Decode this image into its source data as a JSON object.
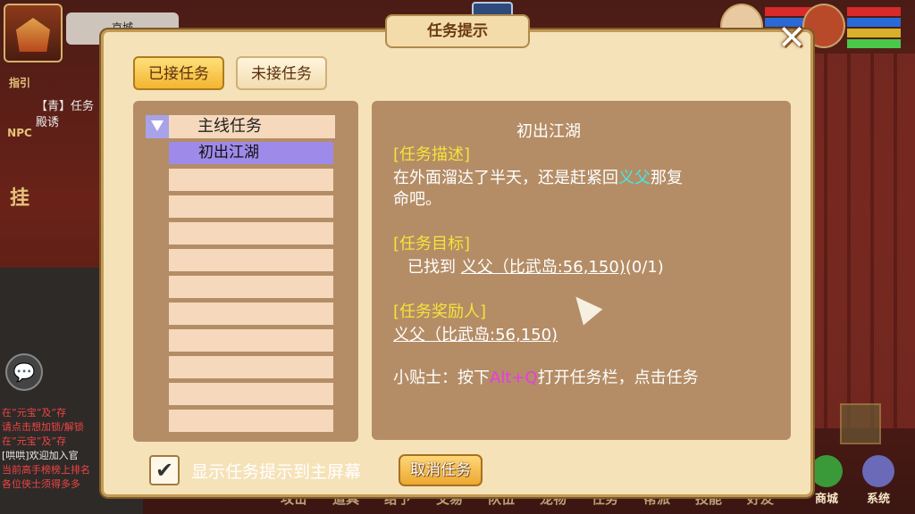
{
  "hud": {
    "location": "京城",
    "left_icons": [
      "指引",
      "NPC",
      "挂"
    ],
    "side_task_lines": [
      "【青】任务",
      "殿诱"
    ],
    "chat_lines": [
      "在”元宝”及”存",
      "请点击想加锁/解锁",
      "在”元宝”及”存",
      "[哄哄]欢迎加入官",
      "当前高手榜榜上排名",
      "各位侠士须得多多"
    ],
    "bottom_menu": [
      "攻击",
      "道具",
      "给予",
      "交易",
      "队伍",
      "宠物",
      "任务",
      "帮派",
      "技能",
      "好友"
    ],
    "mall_label": "商城",
    "system_label": "系统"
  },
  "dialog": {
    "title": "任务提示",
    "close_symbol": "✕",
    "tabs": {
      "accepted": "已接任务",
      "unaccepted": "未接任务"
    },
    "list": {
      "category": "主线任务",
      "items": [
        "初出江湖"
      ]
    },
    "detail": {
      "title": "初出江湖",
      "desc_header": "[任务描述]",
      "desc_line1_pre": "在外面溜达了半天，还是赶紧回",
      "desc_line1_npc": "义父",
      "desc_line1_post": "那复",
      "desc_line2": "命吧。",
      "goal_header": "[任务目标]",
      "goal_pre": "已找到",
      "goal_link": "义父（比武岛:56,150)",
      "goal_progress": "(0/1)",
      "reward_header": "[任务奖励人]",
      "reward_link": "义父（比武岛:56,150)",
      "tip_pre": "小贴士：按下",
      "tip_key": "Alt+Q",
      "tip_post": "打开任务栏，点击任务"
    },
    "show_on_screen_label": "显示任务提示到主屏幕",
    "show_on_screen_checked": true,
    "check_symbol": "✔",
    "cancel_label": "取消任务"
  }
}
